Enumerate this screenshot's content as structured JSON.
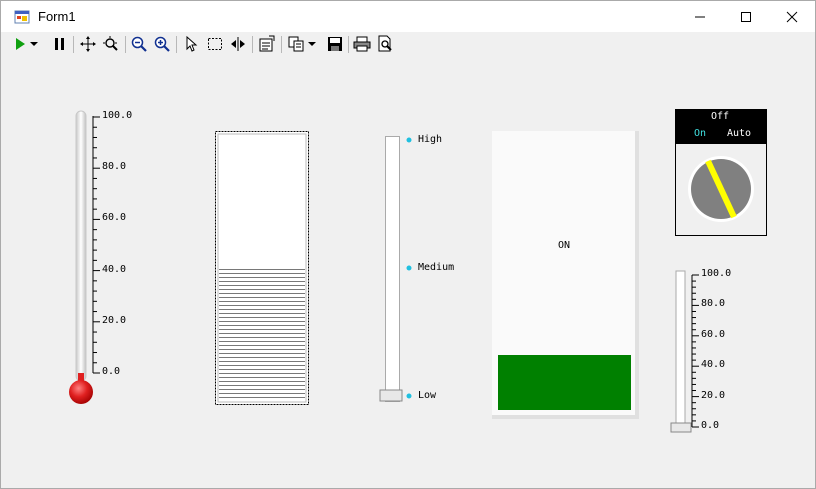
{
  "window": {
    "title": "Form1",
    "minimize_icon": "minimize-icon",
    "maximize_icon": "maximize-icon",
    "close_icon": "close-icon"
  },
  "toolbar": {
    "items": [
      "play-icon",
      "dropdown-arrow-icon",
      "pause-icon",
      "pan-icon",
      "zoom-box-icon",
      "zoom-out-icon",
      "zoom-in-icon",
      "pointer-icon",
      "select-rect-icon",
      "mirror-icon",
      "properties-icon",
      "copy-icon",
      "dropdown-arrow-icon",
      "save-icon",
      "print-icon",
      "print-preview-icon"
    ]
  },
  "thermometer": {
    "ticks": [
      "100.0",
      "80.0",
      "60.0",
      "40.0",
      "20.0",
      "0.0"
    ],
    "min": 0,
    "max": 100,
    "value": 0,
    "bulb_color": "#e02020"
  },
  "tank": {
    "fill_fraction": 0.5
  },
  "selector_switch": {
    "positions": [
      "High",
      "Medium",
      "Low"
    ],
    "selected": "Low",
    "dot_color": "#20c0e0"
  },
  "indicator": {
    "label": "ON",
    "fill_color": "#008000"
  },
  "rotary_switch": {
    "state": "Off",
    "left_option": "On",
    "right_option": "Auto",
    "on_color": "#40e0e0",
    "pointer_color": "#ffff00"
  },
  "slider": {
    "ticks": [
      "100.0",
      "80.0",
      "60.0",
      "40.0",
      "20.0",
      "0.0"
    ],
    "min": 0,
    "max": 100,
    "value": 0
  }
}
